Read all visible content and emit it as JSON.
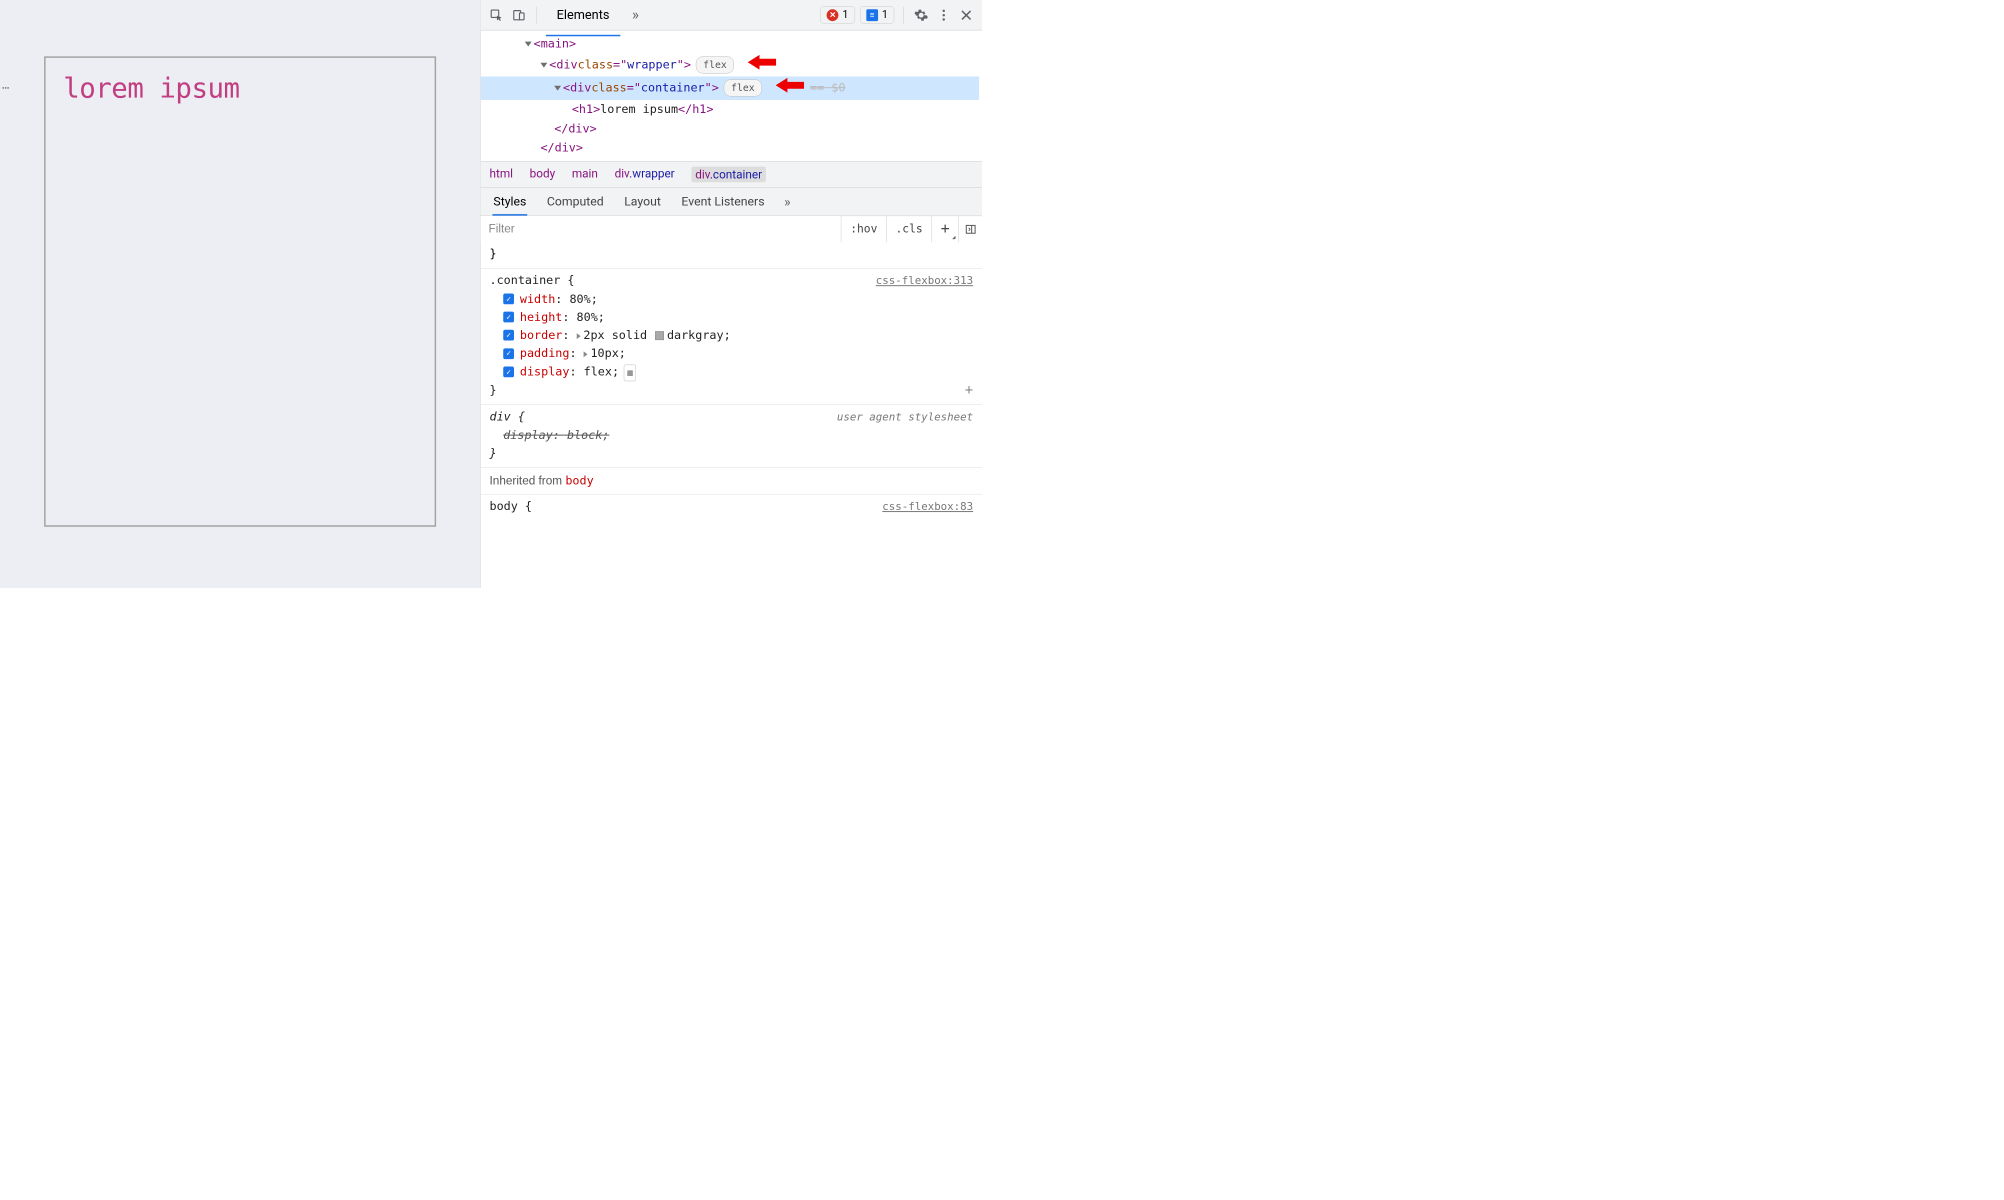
{
  "page": {
    "heading": "lorem ipsum"
  },
  "toolbar": {
    "tabs": [
      "Elements"
    ],
    "active_tab": "Elements",
    "error_count": "1",
    "message_count": "1"
  },
  "dom": {
    "lines": [
      {
        "indent": 90,
        "tri": true,
        "html": "<span class='punct'>&lt;</span><span class='tag'>main</span><span class='punct'>&gt;</span>"
      },
      {
        "indent": 122,
        "tri": true,
        "html": "<span class='punct'>&lt;</span><span class='tag'>div</span> <span class='attr-n'>class</span><span class='punct'>=\"</span><span class='attr-v'>wrapper</span><span class='punct'>\"&gt;</span>",
        "flex": true,
        "arrow": true
      },
      {
        "indent": 150,
        "tri": true,
        "sel": true,
        "dots": true,
        "html": "<span class='punct'>&lt;</span><span class='tag'>div</span> <span class='attr-n'>class</span><span class='punct'>=\"</span><span class='attr-v'>container</span><span class='punct'>\"&gt;</span>",
        "flex": true,
        "arrow": true,
        "ghost": "== $0"
      },
      {
        "indent": 186,
        "tri": false,
        "html": "<span class='punct'>&lt;</span><span class='tag'>h1</span><span class='punct'>&gt;</span><span class='txt'>lorem ipsum</span><span class='punct'>&lt;/</span><span class='tag'>h1</span><span class='punct'>&gt;</span>"
      },
      {
        "indent": 150,
        "tri": false,
        "html": "<span class='punct'>&lt;/</span><span class='tag'>div</span><span class='punct'>&gt;</span>"
      },
      {
        "indent": 122,
        "tri": false,
        "html": "<span class='punct'>&lt;/</span><span class='tag'>div</span><span class='punct'>&gt;</span>"
      }
    ]
  },
  "crumbs": [
    "html",
    "body",
    "main",
    "div.wrapper",
    "div.container"
  ],
  "crumb_active": "div.container",
  "sub_tabs": [
    "Styles",
    "Computed",
    "Layout",
    "Event Listeners"
  ],
  "sub_active": "Styles",
  "filter": {
    "placeholder": "Filter",
    "hov": ":hov",
    "cls": ".cls"
  },
  "styles": {
    "cut_above": "}",
    "rule1": {
      "selector": ".container {",
      "source": "css-flexbox:313",
      "decls": [
        {
          "prop": "width",
          "colon": ":",
          "val": "80%",
          "semi": ";"
        },
        {
          "prop": "height",
          "colon": ":",
          "val": "80%",
          "semi": ";"
        },
        {
          "prop": "border",
          "colon": ":",
          "expand": true,
          "val_pre": "2px solid",
          "swatch": true,
          "val_post": "darkgray",
          "semi": ";"
        },
        {
          "prop": "padding",
          "colon": ":",
          "expand": true,
          "val": "10px",
          "semi": ";"
        },
        {
          "prop": "display",
          "colon": ":",
          "val": "flex",
          "semi": ";",
          "flex_widget": true
        }
      ],
      "close": "}"
    },
    "rule2": {
      "selector": "div {",
      "source": "user agent stylesheet",
      "decl_struck": "display: block;",
      "close": "}"
    },
    "inherited_label": "Inherited from",
    "inherited_tag": "body",
    "rule3_peek": {
      "selector": "body {",
      "source": "css-flexbox:83"
    }
  }
}
